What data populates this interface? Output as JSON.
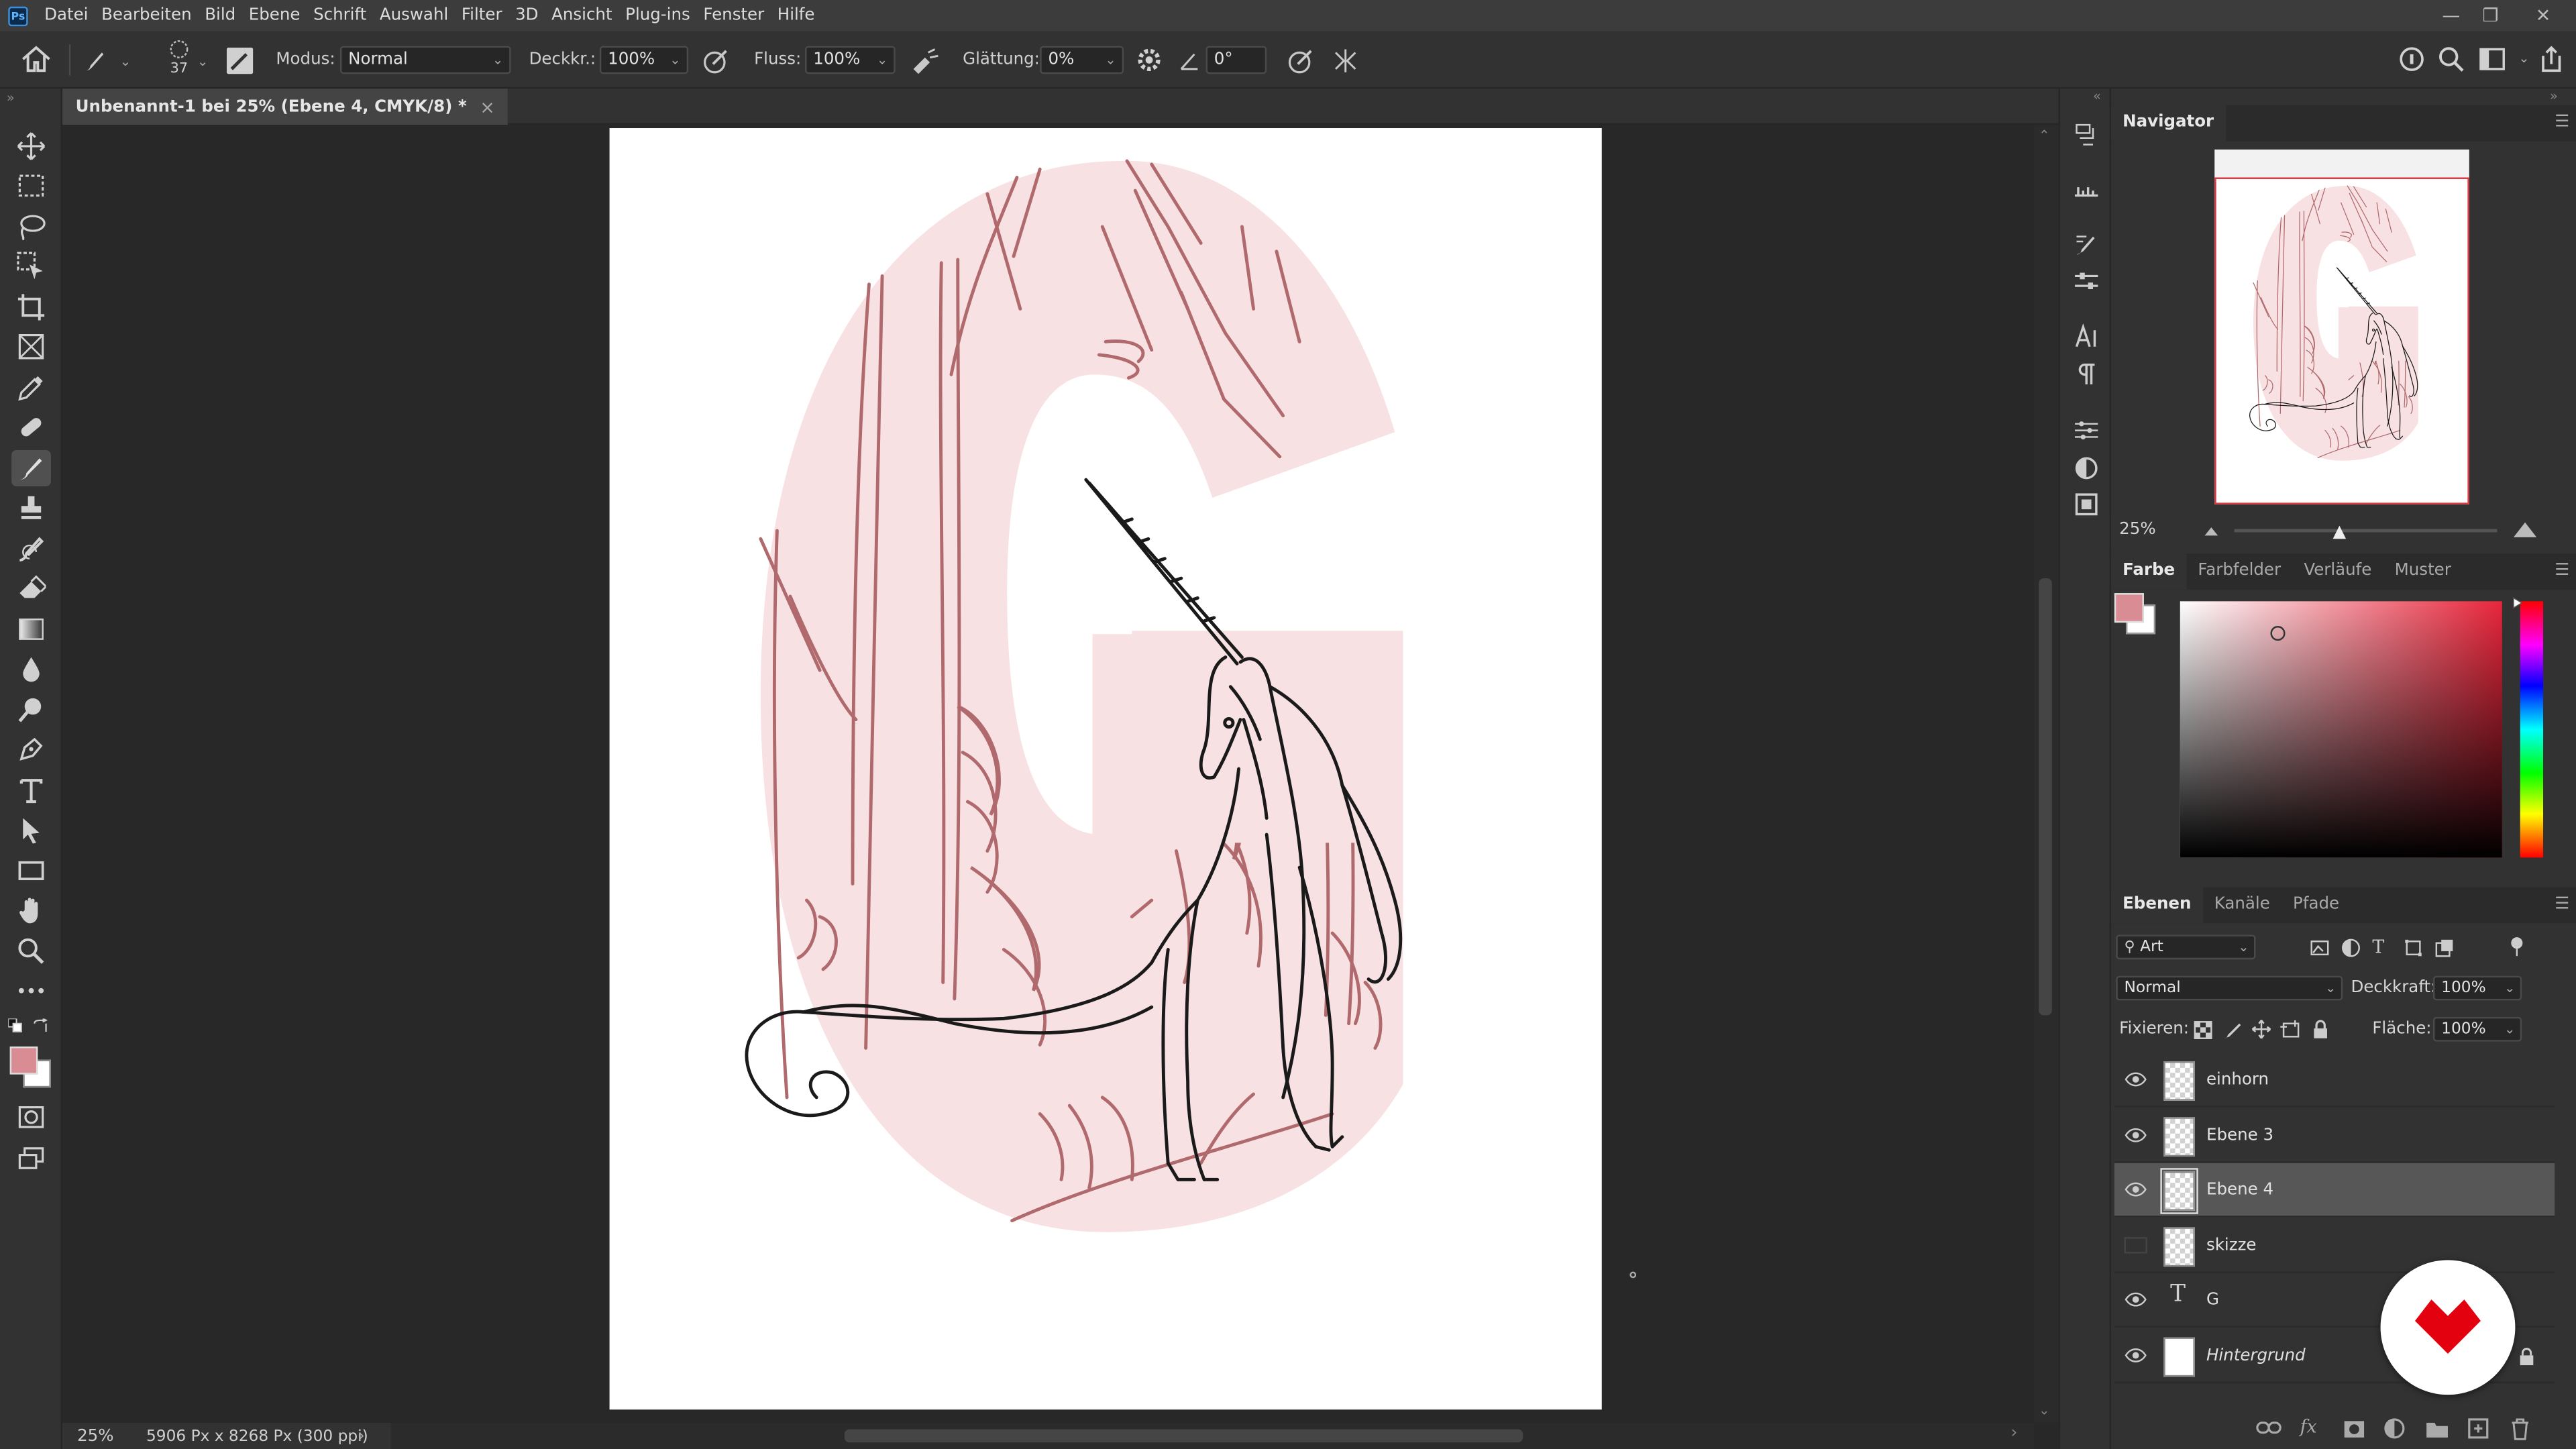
{
  "app": {
    "logo": "Ps"
  },
  "menu": [
    "Datei",
    "Bearbeiten",
    "Bild",
    "Ebene",
    "Schrift",
    "Auswahl",
    "Filter",
    "3D",
    "Ansicht",
    "Plug-ins",
    "Fenster",
    "Hilfe"
  ],
  "window_controls": {
    "minimize": "—",
    "restore": "❐",
    "close": "✕"
  },
  "options": {
    "brush_size": "37",
    "mode_label": "Modus:",
    "mode_value": "Normal",
    "opacity_label": "Deckkr.:",
    "opacity_value": "100%",
    "flow_label": "Fluss:",
    "flow_value": "100%",
    "smoothing_label": "Glättung:",
    "smoothing_value": "0%",
    "angle_value": "0°"
  },
  "document": {
    "tab_title": "Unbenannt-1 bei 25% (Ebene 4, CMYK/8) *",
    "close": "×",
    "zoom": "25%",
    "info": "5906 Px x 8268 Px (300 ppi)",
    "info_arrow": "›",
    "scroll_left": "‹",
    "scroll_right": "›"
  },
  "artwork": {
    "letter_color": "#f8e1e2",
    "sketch_color": "#b06a6d",
    "ink_color": "#1a1a1a"
  },
  "navigator": {
    "title": "Navigator",
    "zoom": "25%"
  },
  "color_panel": {
    "tabs": [
      "Farbe",
      "Farbfelder",
      "Verläufe",
      "Muster"
    ],
    "foreground": "#d98c93",
    "background": "#ffffff",
    "hue_color": "#e8263b"
  },
  "layers_panel": {
    "tabs": [
      "Ebenen",
      "Kanäle",
      "Pfade"
    ],
    "filter_label": "Art",
    "blend_mode": "Normal",
    "opacity_label": "Deckkraft:",
    "opacity_value": "100%",
    "lock_label": "Fixieren:",
    "fill_label": "Fläche:",
    "fill_value": "100%",
    "layers": [
      {
        "name": "einhorn",
        "visible": true,
        "type": "pixel"
      },
      {
        "name": "Ebene 3",
        "visible": true,
        "type": "pixel"
      },
      {
        "name": "Ebene 4",
        "visible": true,
        "type": "pixel",
        "selected": true
      },
      {
        "name": "skizze",
        "visible": false,
        "type": "pixel"
      },
      {
        "name": "G",
        "visible": true,
        "type": "text"
      },
      {
        "name": "Hintergrund",
        "visible": true,
        "type": "background",
        "locked": true
      }
    ],
    "footer_fx": "fx"
  },
  "watermark": {
    "brand_color": "#e3000f"
  }
}
